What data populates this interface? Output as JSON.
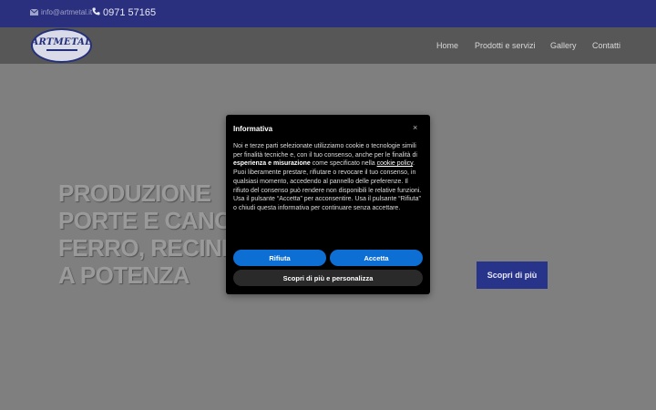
{
  "topbar": {
    "email": "info@artmetal.it",
    "phone": "0971 57165"
  },
  "brand": {
    "logo_text": "ARTMETAL"
  },
  "nav": {
    "items": [
      "Home",
      "Prodotti e servizi",
      "Gallery",
      "Contatti"
    ]
  },
  "hero": {
    "title_lines": [
      "PRODUZIONE",
      "PORTE E CANC",
      "FERRO, RECINI",
      "A POTENZA"
    ],
    "cta_label": "Scopri di più"
  },
  "cookie_modal": {
    "title": "Informativa",
    "close_label": "×",
    "body_1": "Noi e terze parti selezionate utilizziamo cookie o tecnologie simili per finalità tecniche e, con il tuo consenso, anche per le finalità di ",
    "body_bold": "esperienza e misurazione",
    "body_2": " come specificato nella ",
    "cookie_policy_link": "cookie policy",
    "body_3": ". Puoi liberamente prestare, rifiutare o revocare il tuo consenso, in qualsiasi momento, accedendo al pannello delle preferenze. Il rifiuto del consenso può rendere non disponibili le relative funzioni.",
    "body_4": "Usa il pulsante “Accetta” per acconsentire. Usa il pulsante “Rifiuta” o chiudi questa informativa per continuare senza accettare.",
    "reject_label": "Rifiuta",
    "accept_label": "Accetta",
    "customize_label": "Scopri di più e personalizza"
  },
  "colors": {
    "topbar_bg": "#2a2f7e",
    "navbar_bg": "#575757",
    "page_bg": "#7f7f7f",
    "accent_blue": "#0d6fd4",
    "cta_bg": "#28338a"
  }
}
